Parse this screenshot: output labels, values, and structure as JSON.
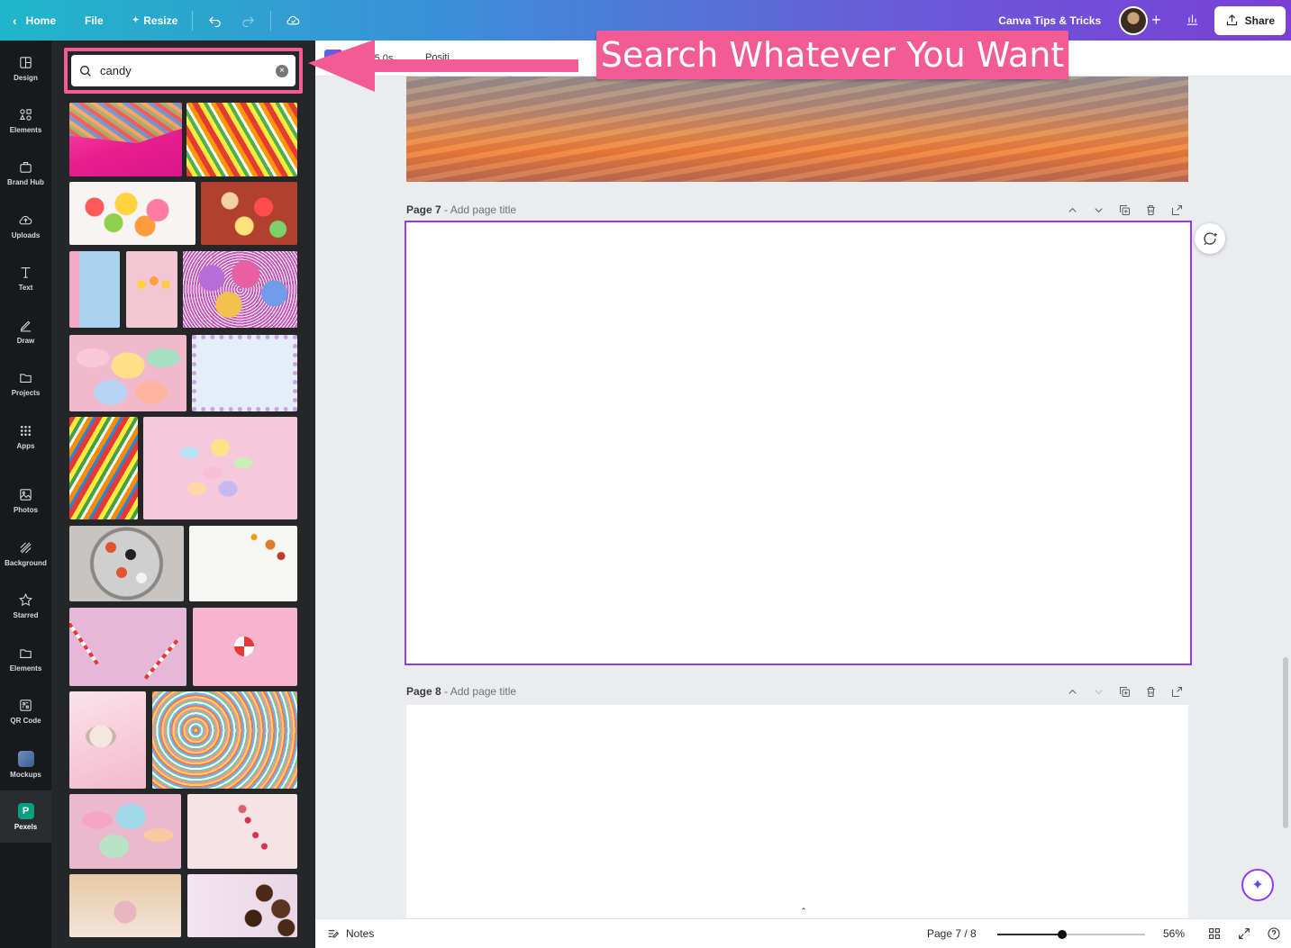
{
  "topbar": {
    "home_label": "Home",
    "file_label": "File",
    "resize_label": "Resize",
    "team_name": "Canva Tips & Tricks",
    "share_label": "Share"
  },
  "rail": {
    "items": [
      {
        "label": "Design",
        "icon": "layout-icon"
      },
      {
        "label": "Elements",
        "icon": "shapes-icon"
      },
      {
        "label": "Brand Hub",
        "icon": "briefcase-icon"
      },
      {
        "label": "Uploads",
        "icon": "cloud-upload-icon"
      },
      {
        "label": "Text",
        "icon": "text-icon"
      },
      {
        "label": "Draw",
        "icon": "pen-icon"
      },
      {
        "label": "Projects",
        "icon": "folder-icon"
      },
      {
        "label": "Apps",
        "icon": "grid-icon"
      },
      {
        "label": "Photos",
        "icon": "image-icon"
      },
      {
        "label": "Background",
        "icon": "hatch-icon"
      },
      {
        "label": "Starred",
        "icon": "star-icon"
      },
      {
        "label": "Elements",
        "icon": "folder-icon"
      },
      {
        "label": "QR Code",
        "icon": "qr-icon"
      },
      {
        "label": "Mockups",
        "icon": "mockup-icon"
      },
      {
        "label": "Pexels",
        "icon": "pexels-icon"
      }
    ],
    "active": "Pexels"
  },
  "search": {
    "value": "candy"
  },
  "context_bar": {
    "duration": "5.0s",
    "position_label": "Positi"
  },
  "pages": {
    "page7_number": "Page 7",
    "page7_title_placeholder": "Add page title",
    "page8_number": "Page 8",
    "page8_title_placeholder": "Add page title"
  },
  "bottombar": {
    "notes_label": "Notes",
    "page_count": "Page 7 / 8",
    "zoom": "56%",
    "zoom_level": 0.44
  },
  "annotation": {
    "text": "Search Whatever You Want",
    "color": "#f25b93"
  },
  "colors": {
    "accent": "#8b3dff",
    "highlight": "#f25b93"
  }
}
